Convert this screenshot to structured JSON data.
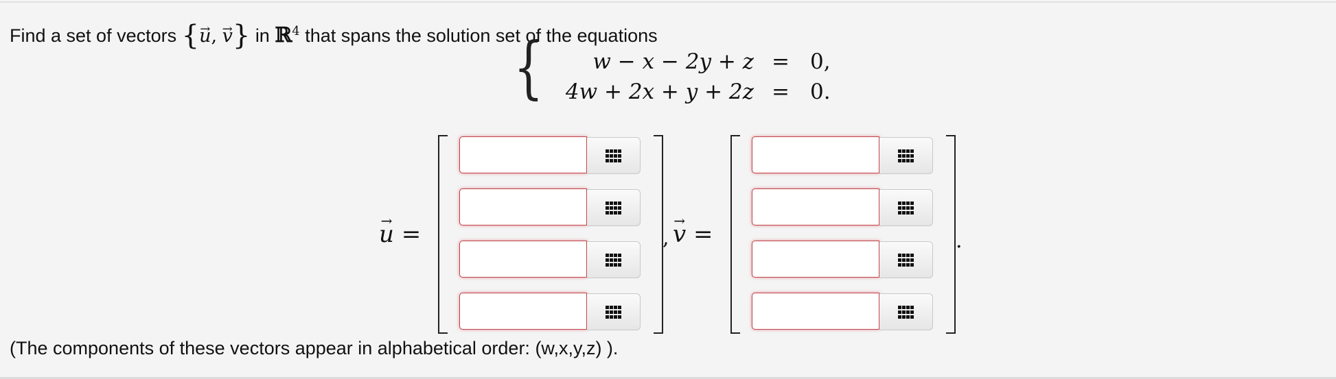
{
  "question": {
    "prefix": "Find a set of vectors",
    "brace_open": "{",
    "u": "u",
    "sep": ",",
    "v": "v",
    "brace_close": "}",
    "in": "in",
    "R": "ℝ",
    "R_exp": "4",
    "suffix": "that spans the solution set of the equations"
  },
  "system": {
    "equations": [
      {
        "lhs": "w − x − 2y + z",
        "rel": "=",
        "rhs": "0,"
      },
      {
        "lhs": "4w + 2x + y + 2z",
        "rel": "=",
        "rhs": "0."
      }
    ]
  },
  "vectors": {
    "u_label": "u",
    "v_label": "v",
    "equals": "=",
    "comma": ",",
    "period": ".",
    "u_values": [
      "",
      "",
      "",
      ""
    ],
    "v_values": [
      "",
      "",
      "",
      ""
    ]
  },
  "footer": "(The components of these vectors appear in alphabetical order: (w,x,y,z) )."
}
